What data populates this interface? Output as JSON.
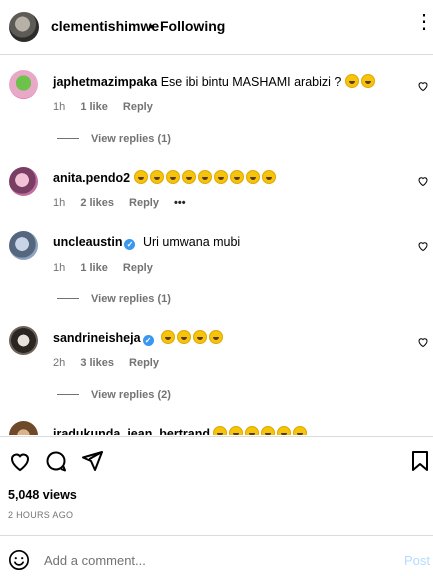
{
  "header": {
    "username": "clementishimwe",
    "separator": "•",
    "following": "Following",
    "more": "⋮"
  },
  "comments": [
    {
      "username": "japhetmazimpaka",
      "text": "Ese ibi bintu MASHAMI arabizi ?",
      "emoji_count": 2,
      "time": "1h",
      "likes": "1 like",
      "reply": "Reply",
      "view_replies": "View replies (1)"
    },
    {
      "username": "anita.pendo2",
      "text": "",
      "emoji_count": 9,
      "time": "1h",
      "likes": "2 likes",
      "reply": "Reply",
      "options": "•••"
    },
    {
      "username": "uncleaustin",
      "text": "Uri umwana mubi",
      "verified": true,
      "time": "1h",
      "likes": "1 like",
      "reply": "Reply",
      "view_replies": "View replies (1)"
    },
    {
      "username": "sandrineisheja",
      "text": "",
      "verified": true,
      "emoji_count": 4,
      "time": "2h",
      "likes": "3 likes",
      "reply": "Reply",
      "view_replies": "View replies (2)"
    },
    {
      "username": "iradukunda_jean_bertrand",
      "text": "",
      "emoji_count": 6
    }
  ],
  "actions": {
    "views": "5,048 views",
    "time_ago": "2 HOURS AGO"
  },
  "add_comment": {
    "placeholder": "Add a comment...",
    "post": "Post"
  },
  "colors": {
    "link_blue": "#0095f6",
    "post_disabled": "#b3dbff",
    "secondary_text": "#737373",
    "verified_blue": "#3897f0"
  },
  "icons": [
    "heart-icon",
    "comment-icon",
    "share-icon",
    "bookmark-icon",
    "emoji-icon",
    "more-icon"
  ]
}
